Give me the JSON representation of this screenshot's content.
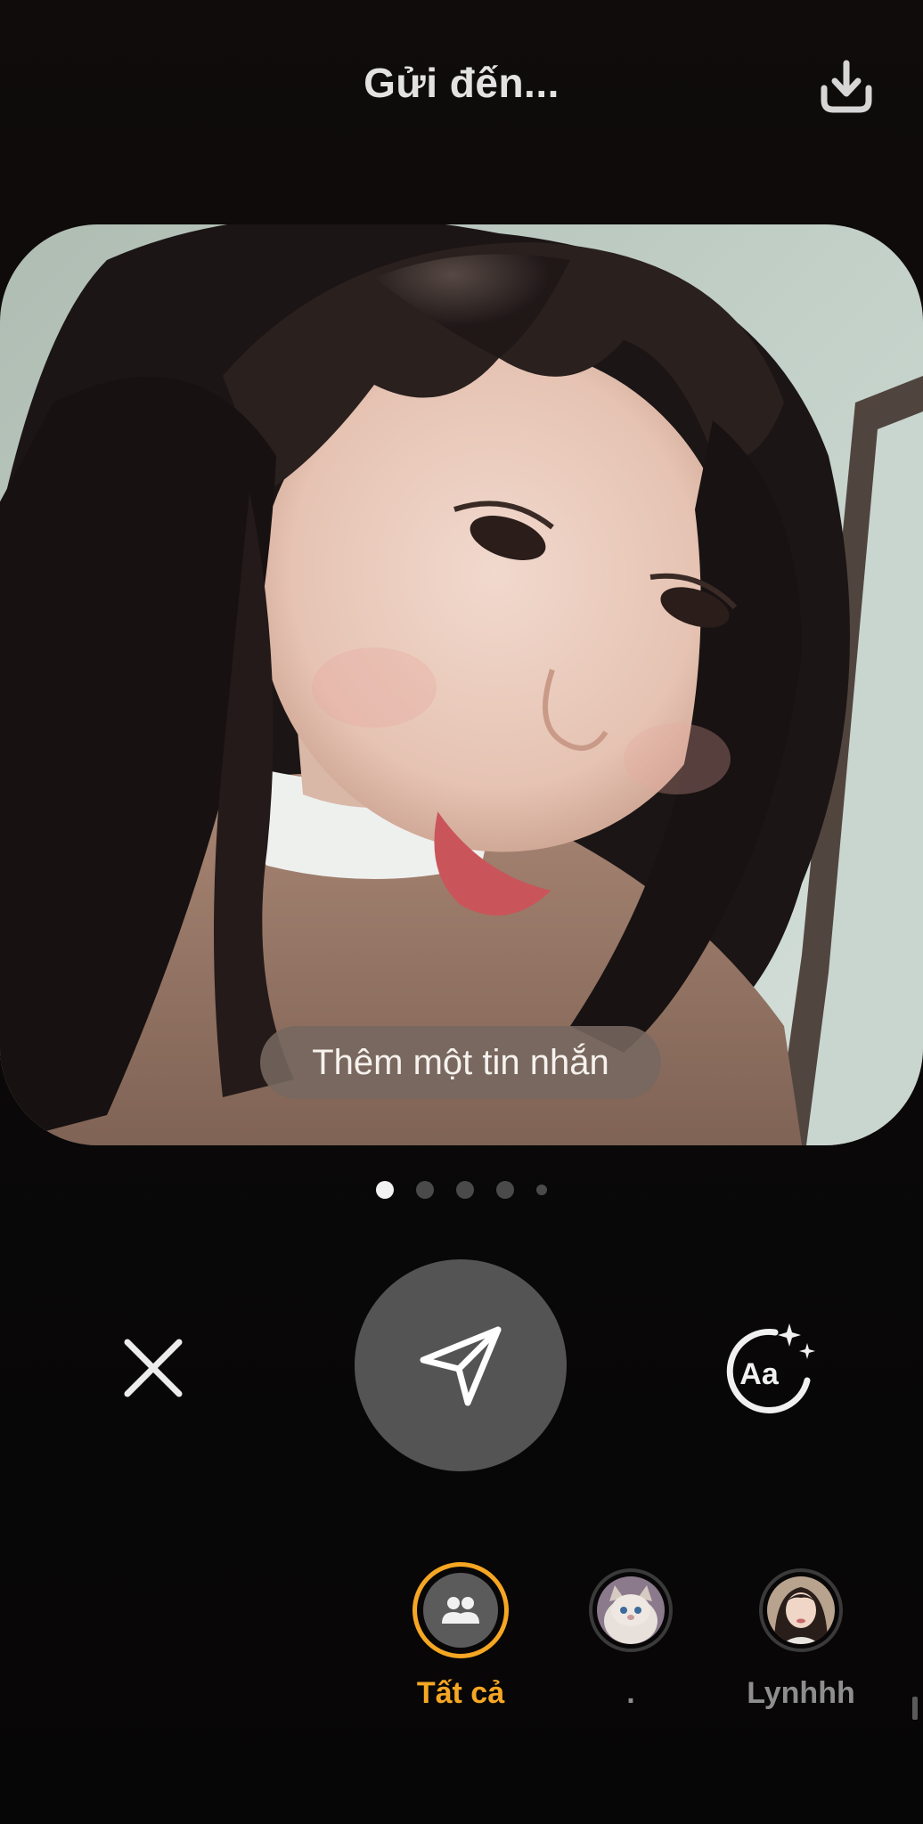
{
  "header": {
    "title": "Gửi đến...",
    "download_icon": "download-icon"
  },
  "photo": {
    "message_placeholder": "Thêm một tin nhắn"
  },
  "pagination": {
    "count": 5,
    "active_index": 0
  },
  "actions": {
    "close_icon": "close-icon",
    "send_icon": "send-icon",
    "text_style_icon": "text-style-sparkle-icon",
    "text_style_label": "Aa"
  },
  "recipients": [
    {
      "label": "Tất cả",
      "icon": "group-icon",
      "selected": true
    },
    {
      "label": ".",
      "icon": "avatar-cat",
      "selected": false
    },
    {
      "label": "Lynhhh",
      "icon": "avatar-girl",
      "selected": false
    }
  ],
  "colors": {
    "accent": "#f5a623",
    "background": "#0c0a0a",
    "send_button": "#545454",
    "inactive_label": "#8e8e8e"
  }
}
